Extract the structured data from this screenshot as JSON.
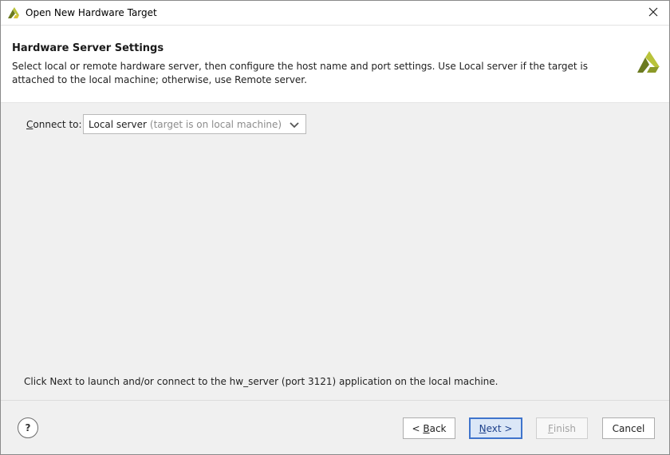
{
  "window": {
    "title": "Open New Hardware Target",
    "close_glyph": "✕"
  },
  "header": {
    "title": "Hardware Server Settings",
    "description": "Select local or remote hardware server, then configure the host name and port settings. Use Local server if the target is attached to the local machine; otherwise, use Remote server."
  },
  "form": {
    "connect_label_mnemonic": "C",
    "connect_label_rest": "onnect to:",
    "server_value": "Local server",
    "server_hint": "(target is on local machine)"
  },
  "info": {
    "message": "Click Next to launch and/or connect to the hw_server (port 3121) application on the local machine."
  },
  "buttons": {
    "help": "?",
    "back_prefix": "< ",
    "back_mnemonic": "B",
    "back_rest": "ack",
    "next_mnemonic": "N",
    "next_rest": "ext >",
    "finish_mnemonic": "F",
    "finish_rest": "inish",
    "cancel": "Cancel"
  },
  "colors": {
    "brand_dark": "#6b7a1f",
    "brand_light": "#b9c33a",
    "accent": "#3f74cc"
  },
  "icons": {
    "app": "vivado-logo-icon",
    "close": "close-icon",
    "dropdown": "chevron-down-icon",
    "help": "help-icon"
  }
}
